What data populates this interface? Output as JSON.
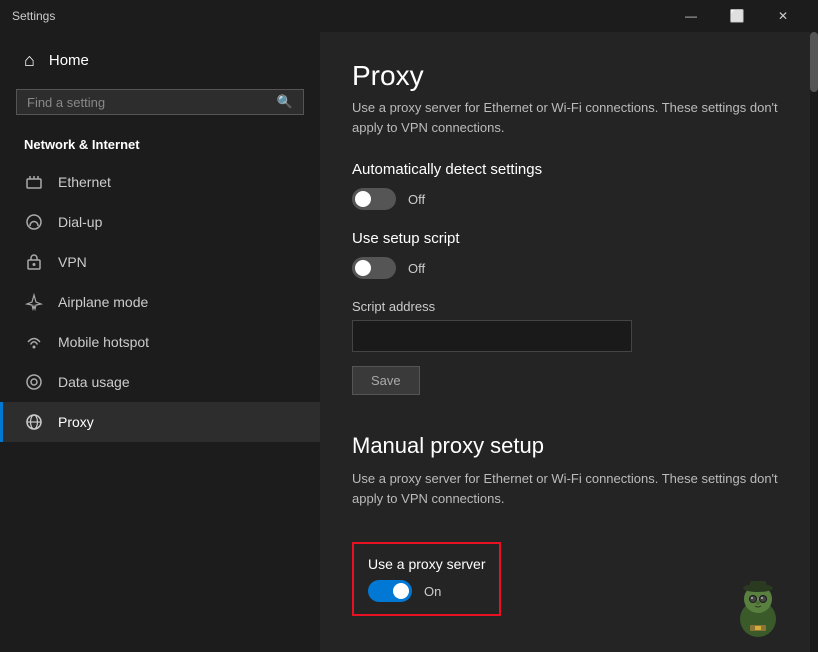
{
  "window": {
    "title": "Settings",
    "controls": {
      "minimize": "—",
      "maximize": "⬜",
      "close": "✕"
    }
  },
  "sidebar": {
    "home_label": "Home",
    "search_placeholder": "Find a setting",
    "section_label": "Network & Internet",
    "nav_items": [
      {
        "id": "ethernet",
        "label": "Ethernet",
        "icon": "🖥"
      },
      {
        "id": "dialup",
        "label": "Dial-up",
        "icon": "📞"
      },
      {
        "id": "vpn",
        "label": "VPN",
        "icon": "🔒"
      },
      {
        "id": "airplane",
        "label": "Airplane mode",
        "icon": "✈"
      },
      {
        "id": "hotspot",
        "label": "Mobile hotspot",
        "icon": "📶"
      },
      {
        "id": "datausage",
        "label": "Data usage",
        "icon": "⊙"
      },
      {
        "id": "proxy",
        "label": "Proxy",
        "icon": "🌐",
        "active": true
      }
    ]
  },
  "main": {
    "page_title": "Proxy",
    "description": "Use a proxy server for Ethernet or Wi-Fi connections. These settings don't apply to VPN connections.",
    "auto_detect_label": "Automatically detect settings",
    "auto_detect_state": "Off",
    "setup_script_label": "Use setup script",
    "setup_script_state": "Off",
    "script_address_label": "Script address",
    "script_address_value": "",
    "script_address_placeholder": "",
    "save_label": "Save",
    "manual_proxy_title": "Manual proxy setup",
    "manual_proxy_desc": "Use a proxy server for Ethernet or Wi-Fi connections. These settings don't apply to VPN connections.",
    "use_proxy_label": "Use a proxy server",
    "use_proxy_state": "On"
  }
}
